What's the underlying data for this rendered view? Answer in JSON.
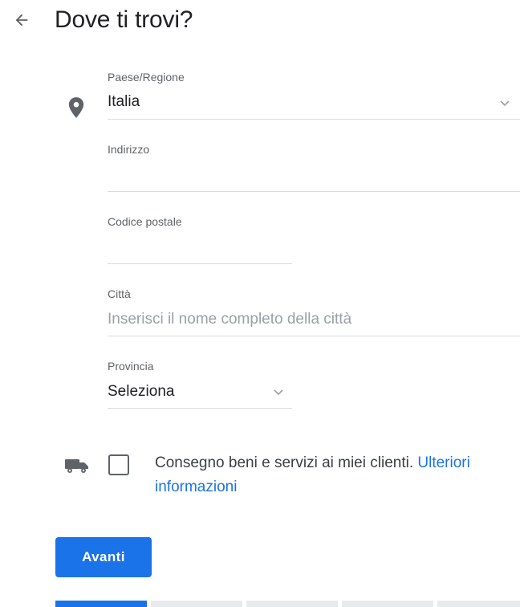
{
  "header": {
    "title": "Dove ti trovi?",
    "back_icon": "arrow-left-icon"
  },
  "form": {
    "country": {
      "label": "Paese/Regione",
      "value": "Italia"
    },
    "address": {
      "label": "Indirizzo",
      "value": ""
    },
    "postal_code": {
      "label": "Codice postale",
      "value": ""
    },
    "city": {
      "label": "Città",
      "placeholder": "Inserisci il nome completo della città",
      "value": ""
    },
    "province": {
      "label": "Provincia",
      "value": "Seleziona"
    }
  },
  "delivery": {
    "checked": false,
    "text": "Consegno beni e servizi ai miei clienti.",
    "link_line1": "Ulteriori",
    "link_line2": "informazioni"
  },
  "actions": {
    "next_label": "Avanti"
  },
  "progress": {
    "total_steps": 5,
    "current_step": 1
  },
  "colors": {
    "accent": "#1a73e8",
    "text": "#202124",
    "muted": "#5f6368",
    "divider": "#dadce0"
  }
}
